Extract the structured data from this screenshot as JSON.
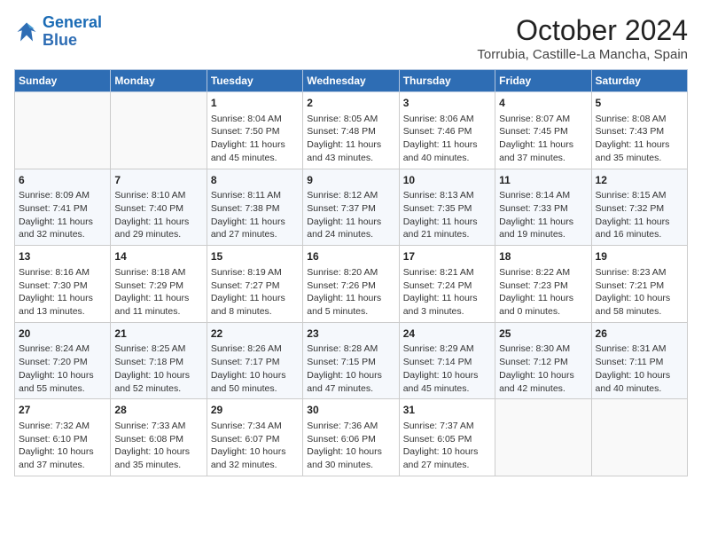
{
  "logo": {
    "line1": "General",
    "line2": "Blue"
  },
  "title": "October 2024",
  "location": "Torrubia, Castille-La Mancha, Spain",
  "days_of_week": [
    "Sunday",
    "Monday",
    "Tuesday",
    "Wednesday",
    "Thursday",
    "Friday",
    "Saturday"
  ],
  "weeks": [
    [
      {
        "day": "",
        "details": ""
      },
      {
        "day": "",
        "details": ""
      },
      {
        "day": "1",
        "details": "Sunrise: 8:04 AM\nSunset: 7:50 PM\nDaylight: 11 hours and 45 minutes."
      },
      {
        "day": "2",
        "details": "Sunrise: 8:05 AM\nSunset: 7:48 PM\nDaylight: 11 hours and 43 minutes."
      },
      {
        "day": "3",
        "details": "Sunrise: 8:06 AM\nSunset: 7:46 PM\nDaylight: 11 hours and 40 minutes."
      },
      {
        "day": "4",
        "details": "Sunrise: 8:07 AM\nSunset: 7:45 PM\nDaylight: 11 hours and 37 minutes."
      },
      {
        "day": "5",
        "details": "Sunrise: 8:08 AM\nSunset: 7:43 PM\nDaylight: 11 hours and 35 minutes."
      }
    ],
    [
      {
        "day": "6",
        "details": "Sunrise: 8:09 AM\nSunset: 7:41 PM\nDaylight: 11 hours and 32 minutes."
      },
      {
        "day": "7",
        "details": "Sunrise: 8:10 AM\nSunset: 7:40 PM\nDaylight: 11 hours and 29 minutes."
      },
      {
        "day": "8",
        "details": "Sunrise: 8:11 AM\nSunset: 7:38 PM\nDaylight: 11 hours and 27 minutes."
      },
      {
        "day": "9",
        "details": "Sunrise: 8:12 AM\nSunset: 7:37 PM\nDaylight: 11 hours and 24 minutes."
      },
      {
        "day": "10",
        "details": "Sunrise: 8:13 AM\nSunset: 7:35 PM\nDaylight: 11 hours and 21 minutes."
      },
      {
        "day": "11",
        "details": "Sunrise: 8:14 AM\nSunset: 7:33 PM\nDaylight: 11 hours and 19 minutes."
      },
      {
        "day": "12",
        "details": "Sunrise: 8:15 AM\nSunset: 7:32 PM\nDaylight: 11 hours and 16 minutes."
      }
    ],
    [
      {
        "day": "13",
        "details": "Sunrise: 8:16 AM\nSunset: 7:30 PM\nDaylight: 11 hours and 13 minutes."
      },
      {
        "day": "14",
        "details": "Sunrise: 8:18 AM\nSunset: 7:29 PM\nDaylight: 11 hours and 11 minutes."
      },
      {
        "day": "15",
        "details": "Sunrise: 8:19 AM\nSunset: 7:27 PM\nDaylight: 11 hours and 8 minutes."
      },
      {
        "day": "16",
        "details": "Sunrise: 8:20 AM\nSunset: 7:26 PM\nDaylight: 11 hours and 5 minutes."
      },
      {
        "day": "17",
        "details": "Sunrise: 8:21 AM\nSunset: 7:24 PM\nDaylight: 11 hours and 3 minutes."
      },
      {
        "day": "18",
        "details": "Sunrise: 8:22 AM\nSunset: 7:23 PM\nDaylight: 11 hours and 0 minutes."
      },
      {
        "day": "19",
        "details": "Sunrise: 8:23 AM\nSunset: 7:21 PM\nDaylight: 10 hours and 58 minutes."
      }
    ],
    [
      {
        "day": "20",
        "details": "Sunrise: 8:24 AM\nSunset: 7:20 PM\nDaylight: 10 hours and 55 minutes."
      },
      {
        "day": "21",
        "details": "Sunrise: 8:25 AM\nSunset: 7:18 PM\nDaylight: 10 hours and 52 minutes."
      },
      {
        "day": "22",
        "details": "Sunrise: 8:26 AM\nSunset: 7:17 PM\nDaylight: 10 hours and 50 minutes."
      },
      {
        "day": "23",
        "details": "Sunrise: 8:28 AM\nSunset: 7:15 PM\nDaylight: 10 hours and 47 minutes."
      },
      {
        "day": "24",
        "details": "Sunrise: 8:29 AM\nSunset: 7:14 PM\nDaylight: 10 hours and 45 minutes."
      },
      {
        "day": "25",
        "details": "Sunrise: 8:30 AM\nSunset: 7:12 PM\nDaylight: 10 hours and 42 minutes."
      },
      {
        "day": "26",
        "details": "Sunrise: 8:31 AM\nSunset: 7:11 PM\nDaylight: 10 hours and 40 minutes."
      }
    ],
    [
      {
        "day": "27",
        "details": "Sunrise: 7:32 AM\nSunset: 6:10 PM\nDaylight: 10 hours and 37 minutes."
      },
      {
        "day": "28",
        "details": "Sunrise: 7:33 AM\nSunset: 6:08 PM\nDaylight: 10 hours and 35 minutes."
      },
      {
        "day": "29",
        "details": "Sunrise: 7:34 AM\nSunset: 6:07 PM\nDaylight: 10 hours and 32 minutes."
      },
      {
        "day": "30",
        "details": "Sunrise: 7:36 AM\nSunset: 6:06 PM\nDaylight: 10 hours and 30 minutes."
      },
      {
        "day": "31",
        "details": "Sunrise: 7:37 AM\nSunset: 6:05 PM\nDaylight: 10 hours and 27 minutes."
      },
      {
        "day": "",
        "details": ""
      },
      {
        "day": "",
        "details": ""
      }
    ]
  ]
}
